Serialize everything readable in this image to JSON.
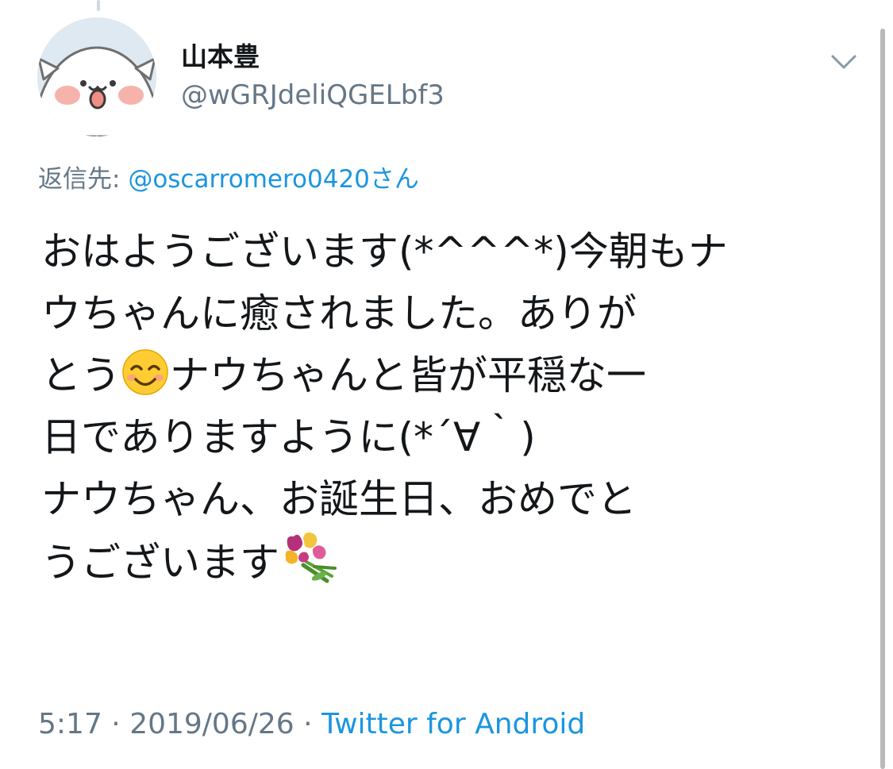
{
  "tweet": {
    "author": {
      "display_name": "山本豊",
      "handle": "@wGRJdeliQGELbf3",
      "avatar_icon": "cat-avatar"
    },
    "menu_icon": "chevron-down-icon",
    "reply_to": {
      "prefix": "返信先:",
      "mention": "@oscarromero0420",
      "suffix": "さん"
    },
    "text_lines": {
      "l1": "おはようございます(*^^^*)今朝もナ",
      "l2": "ウちゃんに癒されました。ありが",
      "l3a": "とう",
      "l3b": "ナウちゃんと皆が平穏な一",
      "l4": "日でありますように(*´∀｀)",
      "l5": "ナウちゃん、お誕生日、おめでと",
      "l6": "うございます"
    },
    "emojis": [
      "smiling-face-emoji",
      "bouquet-emoji"
    ],
    "meta": {
      "time": "5:17",
      "sep1": " · ",
      "date": "2019/06/26",
      "sep2": " · ",
      "source": "Twitter for Android"
    },
    "colors": {
      "text": "#14171a",
      "secondary": "#657786",
      "link": "#1b95e0"
    }
  }
}
